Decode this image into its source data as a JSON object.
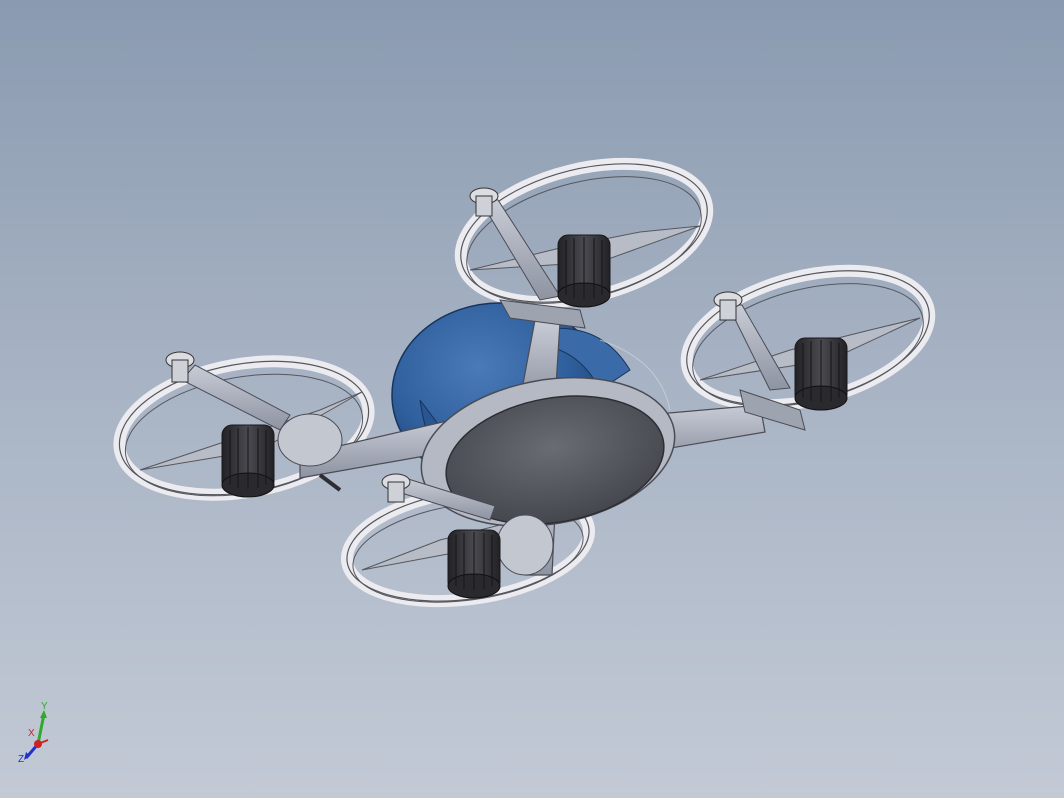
{
  "viewport": {
    "background_top": "#8a9ab0",
    "background_bottom": "#c3cad6"
  },
  "model": {
    "body_color": "#2f5f9c",
    "frame_color": "#aeb2bf",
    "guard_color": "#e6e6ea",
    "motor_color": "#3a3a3e",
    "plate_color": "#55575e"
  },
  "triad": {
    "y_label": "Y",
    "x_label": "X",
    "z_label": "Z",
    "y_color": "#2eaa2e",
    "x_color": "#cc2222",
    "z_color": "#2233cc"
  }
}
